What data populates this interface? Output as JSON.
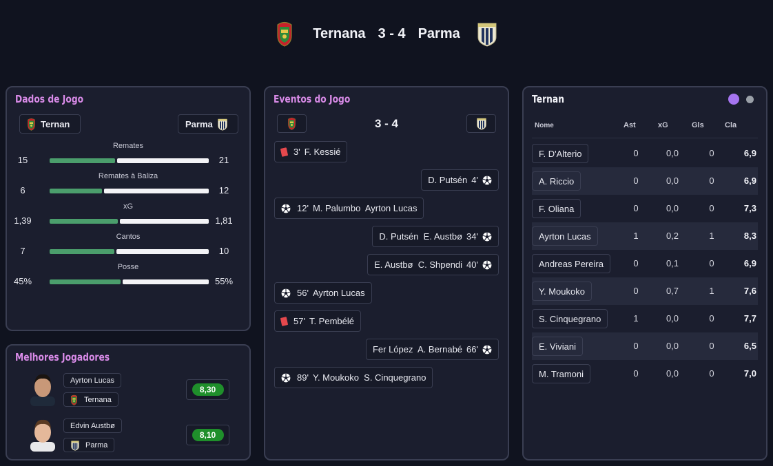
{
  "header": {
    "home": "Ternana",
    "score": "3 - 4",
    "away": "Parma"
  },
  "stats_panel": {
    "title": "Dados de Jogo",
    "home": "Ternan",
    "away": "Parma",
    "rows": [
      {
        "label": "Remates",
        "home": "15",
        "away": "21",
        "home_share": 0.4167
      },
      {
        "label": "Remates à Baliza",
        "home": "6",
        "away": "12",
        "home_share": 0.3333
      },
      {
        "label": "xG",
        "home": "1,39",
        "away": "1,81",
        "home_share": 0.4344
      },
      {
        "label": "Cantos",
        "home": "7",
        "away": "10",
        "home_share": 0.4118
      },
      {
        "label": "Posse",
        "home": "45%",
        "away": "55%",
        "home_share": 0.45
      }
    ]
  },
  "best_players": {
    "title": "Melhores Jogadores",
    "players": [
      {
        "name": "Ayrton Lucas",
        "team": "Ternana",
        "rating": "8,30"
      },
      {
        "name": "Edvin Austbø",
        "team": "Parma",
        "rating": "8,10"
      }
    ]
  },
  "events_panel": {
    "title": "Eventos do Jogo",
    "score": "3 - 4",
    "events": [
      {
        "side": "home",
        "kind": "red",
        "minute": "3'",
        "text": "F. Kessié"
      },
      {
        "side": "away",
        "kind": "goal",
        "minute": "4'",
        "text": "D. Putsén"
      },
      {
        "side": "home",
        "kind": "goal",
        "minute": "12'",
        "text": "M. Palumbo  Ayrton Lucas"
      },
      {
        "side": "away",
        "kind": "goal",
        "minute": "34'",
        "text": "D. Putsén  E. Austbø"
      },
      {
        "side": "away",
        "kind": "goal",
        "minute": "40'",
        "text": "E. Austbø  C. Shpendi"
      },
      {
        "side": "home",
        "kind": "goal",
        "minute": "56'",
        "text": "Ayrton Lucas"
      },
      {
        "side": "home",
        "kind": "red",
        "minute": "57'",
        "text": "T. Pembélé"
      },
      {
        "side": "away",
        "kind": "goal",
        "minute": "66'",
        "text": "Fer López  A. Bernabé"
      },
      {
        "side": "home",
        "kind": "goal",
        "minute": "89'",
        "text": "Y. Moukoko  S. Cinquegrano"
      }
    ]
  },
  "lineup_panel": {
    "title": "Ternan",
    "columns": {
      "name": "Nome",
      "ast": "Ast",
      "xg": "xG",
      "gls": "Gls",
      "cla": "Cla"
    },
    "toggle_colors": {
      "active": "#a675f0",
      "inactive": "#9aa0a8"
    },
    "players": [
      {
        "name": "F. D'Alterio",
        "ast": "0",
        "xg": "0,0",
        "gls": "0",
        "cla": "6,9"
      },
      {
        "name": "A. Riccio",
        "ast": "0",
        "xg": "0,0",
        "gls": "0",
        "cla": "6,9"
      },
      {
        "name": "F. Oliana",
        "ast": "0",
        "xg": "0,0",
        "gls": "0",
        "cla": "7,3"
      },
      {
        "name": "Ayrton Lucas",
        "ast": "1",
        "xg": "0,2",
        "gls": "1",
        "cla": "8,3"
      },
      {
        "name": "Andreas Pereira",
        "ast": "0",
        "xg": "0,1",
        "gls": "0",
        "cla": "6,9"
      },
      {
        "name": "Y. Moukoko",
        "ast": "0",
        "xg": "0,7",
        "gls": "1",
        "cla": "7,6"
      },
      {
        "name": "S. Cinquegrano",
        "ast": "1",
        "xg": "0,0",
        "gls": "0",
        "cla": "7,7"
      },
      {
        "name": "E. Viviani",
        "ast": "0",
        "xg": "0,0",
        "gls": "0",
        "cla": "6,5"
      },
      {
        "name": "M. Tramoni",
        "ast": "0",
        "xg": "0,0",
        "gls": "0",
        "cla": "7,0"
      }
    ]
  }
}
